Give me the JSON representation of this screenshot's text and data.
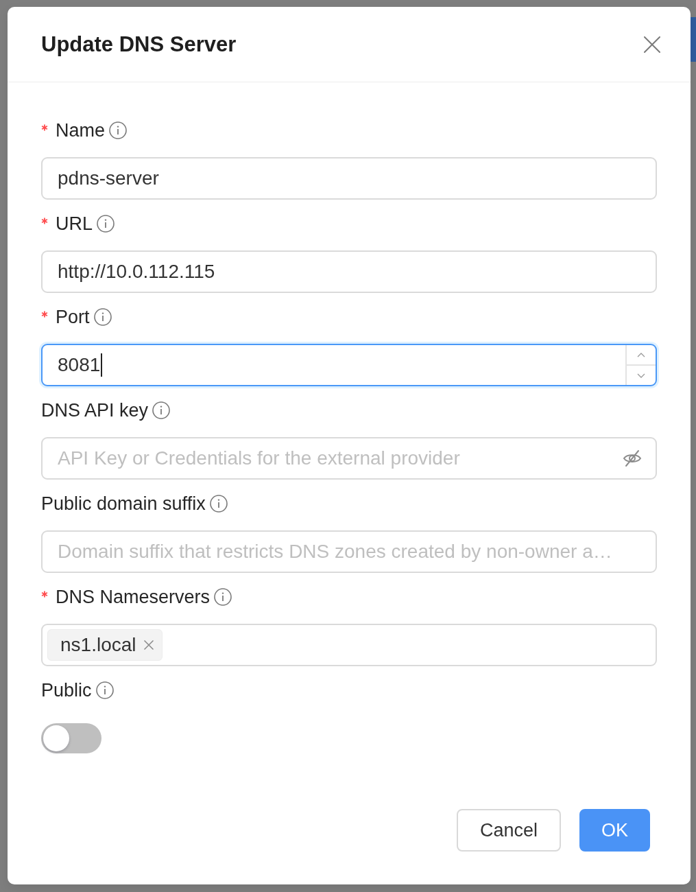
{
  "dialog": {
    "title": "Update DNS Server"
  },
  "fields": [
    {
      "kind": "text",
      "label": "Name",
      "required": true,
      "focused": false,
      "value": "pdns-server"
    },
    {
      "kind": "text",
      "label": "URL",
      "required": true,
      "focused": false,
      "value": "http://10.0.112.115"
    },
    {
      "kind": "number",
      "label": "Port",
      "required": true,
      "focused": true,
      "value": "8081"
    },
    {
      "kind": "password",
      "label": "DNS API key",
      "required": false,
      "focused": false,
      "placeholder": "API Key or Credentials for the external provider"
    },
    {
      "kind": "text",
      "label": "Public domain suffix",
      "required": false,
      "focused": false,
      "placeholder": "Domain suffix that restricts DNS zones created by non-owner a…"
    },
    {
      "kind": "tags",
      "label": "DNS Nameservers",
      "required": true,
      "focused": false,
      "tags": [
        "ns1.local"
      ]
    },
    {
      "kind": "switch",
      "label": "Public",
      "required": false,
      "focused": false,
      "on": false
    }
  ],
  "buttons": [
    {
      "label": "Cancel",
      "kind": "default"
    },
    {
      "label": "OK",
      "kind": "primary"
    }
  ]
}
